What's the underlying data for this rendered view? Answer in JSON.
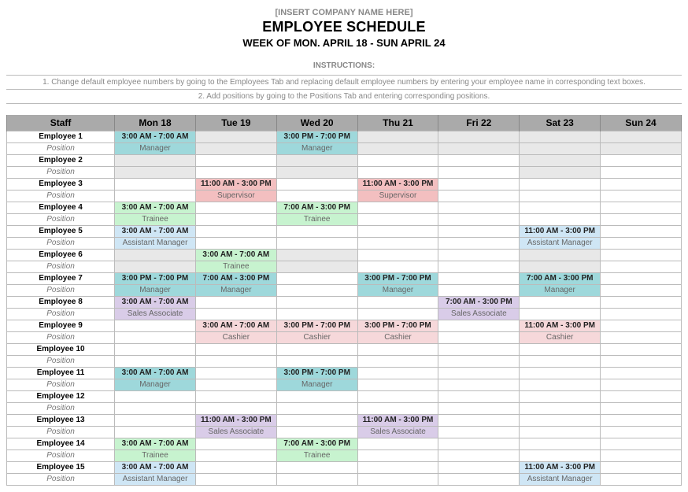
{
  "header": {
    "company": "[INSERT COMPANY NAME HERE]",
    "title": "EMPLOYEE SCHEDULE",
    "subtitle": "WEEK OF MON. APRIL 18 - SUN APRIL 24"
  },
  "instructions": {
    "label": "INSTRUCTIONS:",
    "lines": [
      "1. Change default employee numbers by going to the Employees Tab and replacing default employee numbers by entering your employee name in corresponding text boxes.",
      "2. Add positions by going to the Positions Tab and entering corresponding positions."
    ]
  },
  "columns": {
    "staff": "Staff",
    "position_label": "Position",
    "days": [
      "Mon 18",
      "Tue 19",
      "Wed 20",
      "Thu 21",
      "Fri 22",
      "Sat 23",
      "Sun 24"
    ]
  },
  "colors": {
    "Manager-teal": "c-teal",
    "Supervisor": "c-red",
    "Trainee": "c-green",
    "Assistant Manager": "c-blue",
    "Sales Associate": "c-purple",
    "Cashier": "c-pink",
    "gray": "c-gray"
  },
  "employees": [
    {
      "name": "Employee 1",
      "shifts": [
        {
          "time": "3:00 AM - 7:00 AM",
          "role": "Manager",
          "cls": "c-teal"
        },
        {
          "cls": "c-gray"
        },
        {
          "time": "3:00 PM - 7:00 PM",
          "role": "Manager",
          "cls": "c-teal"
        },
        {
          "cls": "c-gray"
        },
        {
          "cls": "c-gray"
        },
        {
          "cls": "c-gray"
        },
        {
          "cls": "c-gray"
        }
      ]
    },
    {
      "name": "Employee 2",
      "shifts": [
        {
          "cls": "c-gray"
        },
        {},
        {
          "cls": "c-gray"
        },
        {},
        {},
        {
          "cls": "c-gray"
        },
        {}
      ]
    },
    {
      "name": "Employee 3",
      "shifts": [
        {},
        {
          "time": "11:00 AM - 3:00 PM",
          "role": "Supervisor",
          "cls": "c-red"
        },
        {},
        {
          "time": "11:00 AM - 3:00 PM",
          "role": "Supervisor",
          "cls": "c-red"
        },
        {},
        {},
        {}
      ]
    },
    {
      "name": "Employee 4",
      "shifts": [
        {
          "time": "3:00 AM - 7:00 AM",
          "role": "Trainee",
          "cls": "c-green"
        },
        {},
        {
          "time": "7:00 AM - 3:00 PM",
          "role": "Trainee",
          "cls": "c-green"
        },
        {},
        {},
        {},
        {}
      ]
    },
    {
      "name": "Employee 5",
      "shifts": [
        {
          "time": "3:00 AM - 7:00 AM",
          "role": "Assistant Manager",
          "cls": "c-blue"
        },
        {},
        {},
        {},
        {},
        {
          "time": "11:00 AM - 3:00 PM",
          "role": "Assistant Manager",
          "cls": "c-blue"
        },
        {}
      ]
    },
    {
      "name": "Employee 6",
      "shifts": [
        {
          "cls": "c-gray"
        },
        {
          "time": "3:00 AM - 7:00 AM",
          "role": "Trainee",
          "cls": "c-green"
        },
        {
          "cls": "c-gray"
        },
        {},
        {},
        {
          "cls": "c-gray"
        },
        {}
      ]
    },
    {
      "name": "Employee 7",
      "shifts": [
        {
          "time": "3:00 PM - 7:00 PM",
          "role": "Manager",
          "cls": "c-teal"
        },
        {
          "time": "7:00 AM - 3:00 PM",
          "role": "Manager",
          "cls": "c-teal"
        },
        {},
        {
          "time": "3:00 PM - 7:00 PM",
          "role": "Manager",
          "cls": "c-teal"
        },
        {},
        {
          "time": "7:00 AM - 3:00 PM",
          "role": "Manager",
          "cls": "c-teal"
        },
        {}
      ]
    },
    {
      "name": "Employee 8",
      "shifts": [
        {
          "time": "3:00 AM - 7:00 AM",
          "role": "Sales Associate",
          "cls": "c-purple"
        },
        {},
        {},
        {},
        {
          "time": "7:00 AM - 3:00 PM",
          "role": "Sales Associate",
          "cls": "c-purple"
        },
        {},
        {}
      ]
    },
    {
      "name": "Employee 9",
      "shifts": [
        {},
        {
          "time": "3:00 AM - 7:00 AM",
          "role": "Cashier",
          "cls": "c-pink"
        },
        {
          "time": "3:00 PM - 7:00 PM",
          "role": "Cashier",
          "cls": "c-pink"
        },
        {
          "time": "3:00 PM - 7:00 PM",
          "role": "Cashier",
          "cls": "c-pink"
        },
        {},
        {
          "time": "11:00 AM - 3:00 PM",
          "role": "Cashier",
          "cls": "c-pink"
        },
        {}
      ]
    },
    {
      "name": "Employee 10",
      "shifts": [
        {},
        {},
        {},
        {},
        {},
        {},
        {}
      ]
    },
    {
      "name": "Employee 11",
      "shifts": [
        {
          "time": "3:00 AM - 7:00 AM",
          "role": "Manager",
          "cls": "c-teal"
        },
        {},
        {
          "time": "3:00 PM - 7:00 PM",
          "role": "Manager",
          "cls": "c-teal"
        },
        {},
        {},
        {},
        {}
      ]
    },
    {
      "name": "Employee 12",
      "shifts": [
        {},
        {},
        {},
        {},
        {},
        {},
        {}
      ]
    },
    {
      "name": "Employee 13",
      "shifts": [
        {},
        {
          "time": "11:00 AM - 3:00 PM",
          "role": "Sales Associate",
          "cls": "c-purple"
        },
        {},
        {
          "time": "11:00 AM - 3:00 PM",
          "role": "Sales Associate",
          "cls": "c-purple"
        },
        {},
        {},
        {}
      ]
    },
    {
      "name": "Employee 14",
      "shifts": [
        {
          "time": "3:00 AM - 7:00 AM",
          "role": "Trainee",
          "cls": "c-green"
        },
        {},
        {
          "time": "7:00 AM - 3:00 PM",
          "role": "Trainee",
          "cls": "c-green"
        },
        {},
        {},
        {},
        {}
      ]
    },
    {
      "name": "Employee 15",
      "shifts": [
        {
          "time": "3:00 AM - 7:00 AM",
          "role": "Assistant Manager",
          "cls": "c-blue"
        },
        {},
        {},
        {},
        {},
        {
          "time": "11:00 AM - 3:00 PM",
          "role": "Assistant Manager",
          "cls": "c-blue"
        },
        {}
      ]
    }
  ]
}
